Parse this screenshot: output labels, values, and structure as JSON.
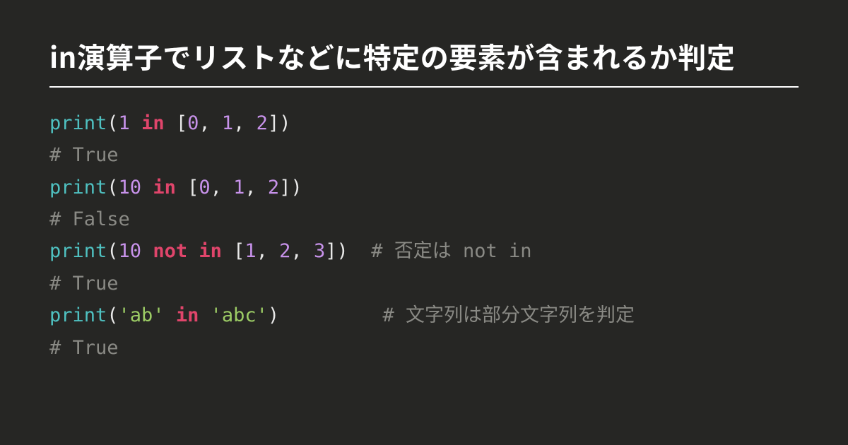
{
  "title": "in演算子でリストなどに特定の要素が含まれるか判定",
  "colors": {
    "background": "#262624",
    "title": "#ffffff",
    "rule": "#ffffff",
    "function": "#4fc1c1",
    "punctuation": "#e8e8e8",
    "number": "#c792ea",
    "keyword": "#e0456b",
    "string": "#9ccc65",
    "comment": "#8a8a85"
  },
  "code_lines": [
    {
      "tokens": [
        {
          "cls": "fn",
          "t": "print"
        },
        {
          "cls": "pn",
          "t": "("
        },
        {
          "cls": "num",
          "t": "1"
        },
        {
          "cls": "pn",
          "t": " "
        },
        {
          "cls": "kw",
          "t": "in"
        },
        {
          "cls": "pn",
          "t": " ["
        },
        {
          "cls": "num",
          "t": "0"
        },
        {
          "cls": "pn",
          "t": ", "
        },
        {
          "cls": "num",
          "t": "1"
        },
        {
          "cls": "pn",
          "t": ", "
        },
        {
          "cls": "num",
          "t": "2"
        },
        {
          "cls": "pn",
          "t": "])"
        }
      ]
    },
    {
      "tokens": [
        {
          "cls": "cmt",
          "t": "# True"
        }
      ]
    },
    {
      "tokens": [
        {
          "cls": "fn",
          "t": "print"
        },
        {
          "cls": "pn",
          "t": "("
        },
        {
          "cls": "num",
          "t": "10"
        },
        {
          "cls": "pn",
          "t": " "
        },
        {
          "cls": "kw",
          "t": "in"
        },
        {
          "cls": "pn",
          "t": " ["
        },
        {
          "cls": "num",
          "t": "0"
        },
        {
          "cls": "pn",
          "t": ", "
        },
        {
          "cls": "num",
          "t": "1"
        },
        {
          "cls": "pn",
          "t": ", "
        },
        {
          "cls": "num",
          "t": "2"
        },
        {
          "cls": "pn",
          "t": "])"
        }
      ]
    },
    {
      "tokens": [
        {
          "cls": "cmt",
          "t": "# False"
        }
      ]
    },
    {
      "tokens": [
        {
          "cls": "fn",
          "t": "print"
        },
        {
          "cls": "pn",
          "t": "("
        },
        {
          "cls": "num",
          "t": "10"
        },
        {
          "cls": "pn",
          "t": " "
        },
        {
          "cls": "kw",
          "t": "not in"
        },
        {
          "cls": "pn",
          "t": " ["
        },
        {
          "cls": "num",
          "t": "1"
        },
        {
          "cls": "pn",
          "t": ", "
        },
        {
          "cls": "num",
          "t": "2"
        },
        {
          "cls": "pn",
          "t": ", "
        },
        {
          "cls": "num",
          "t": "3"
        },
        {
          "cls": "pn",
          "t": "])  "
        },
        {
          "cls": "cmt",
          "t": "# 否定は not in"
        }
      ]
    },
    {
      "tokens": [
        {
          "cls": "cmt",
          "t": "# True"
        }
      ]
    },
    {
      "tokens": [
        {
          "cls": "fn",
          "t": "print"
        },
        {
          "cls": "pn",
          "t": "("
        },
        {
          "cls": "str",
          "t": "'ab'"
        },
        {
          "cls": "pn",
          "t": " "
        },
        {
          "cls": "kw",
          "t": "in"
        },
        {
          "cls": "pn",
          "t": " "
        },
        {
          "cls": "str",
          "t": "'abc'"
        },
        {
          "cls": "pn",
          "t": ")         "
        },
        {
          "cls": "cmt",
          "t": "# 文字列は部分文字列を判定"
        }
      ]
    },
    {
      "tokens": [
        {
          "cls": "cmt",
          "t": "# True"
        }
      ]
    }
  ]
}
